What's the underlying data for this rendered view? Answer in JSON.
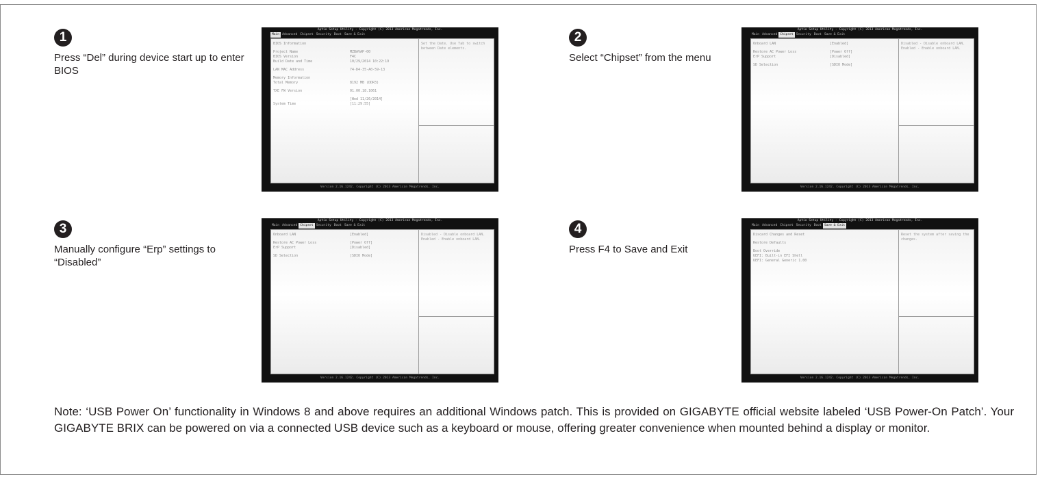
{
  "steps": [
    {
      "number": "1",
      "text": "Press “Del” during device start up to enter BIOS"
    },
    {
      "number": "2",
      "text": "Select “Chipset” from the menu"
    },
    {
      "number": "3",
      "text": "Manually configure “Erp” settings to “Disabled”"
    },
    {
      "number": "4",
      "text": "Press F4 to Save and Exit"
    }
  ],
  "bios": {
    "title": "Aptio Setup Utility - Copyright (C) 2013 American Megatrends, Inc.",
    "footer": "Version 2.16.1242. Copyright (C) 2013 American Megatrends, Inc.",
    "tabs": [
      "Main",
      "Advanced",
      "Chipset",
      "Security",
      "Boot",
      "Save & Exit"
    ],
    "screens": [
      {
        "active_tab": 0,
        "rows": [
          {
            "label": "BIOS Information",
            "value": "",
            "gap": false
          },
          {
            "label": "Project Name",
            "value": "MZBAVAP-00",
            "gap": true
          },
          {
            "label": "BIOS Version",
            "value": "F4C",
            "gap": false
          },
          {
            "label": "Build Date and Time",
            "value": "10/29/2014 10:22:19",
            "gap": false
          },
          {
            "label": "LAN MAC Address",
            "value": "74-D4-35-A0-59-13",
            "gap": true
          },
          {
            "label": "Memory Information",
            "value": "",
            "gap": true
          },
          {
            "label": "Total Memory",
            "value": "8192 MB (DDR3)",
            "gap": false
          },
          {
            "label": "TXE FW Version",
            "value": "01.00.18.1061",
            "gap": true
          },
          {
            "label": "",
            "value": "[Wed 11/26/2014]",
            "gap": true
          },
          {
            "label": "System Time",
            "value": "[11:29:55]",
            "gap": false
          }
        ],
        "help": "Set the Date. Use Tab to switch between Date elements."
      },
      {
        "active_tab": 2,
        "rows": [
          {
            "label": "Onboard LAN",
            "value": "[Enabled]",
            "gap": false
          },
          {
            "label": "Restore AC Power Loss",
            "value": "[Power Off]",
            "gap": true
          },
          {
            "label": "ErP Support",
            "value": "[Disabled]",
            "gap": false
          },
          {
            "label": "SD Selection",
            "value": "[SDIO Mode]",
            "gap": true
          }
        ],
        "help": "Disabled - Disable onboard LAN. Enabled - Enable onboard LAN."
      },
      {
        "active_tab": 2,
        "rows": [
          {
            "label": "Onboard LAN",
            "value": "[Enabled]",
            "gap": false
          },
          {
            "label": "Restore AC Power Loss",
            "value": "[Power Off]",
            "gap": true
          },
          {
            "label": "ErP Support",
            "value": "[Disabled]",
            "gap": false
          },
          {
            "label": "SD Selection",
            "value": "[SDIO Mode]",
            "gap": true
          }
        ],
        "help": "Disabled - Disable onboard LAN. Enabled - Enable onboard LAN."
      },
      {
        "active_tab": 5,
        "rows": [
          {
            "label": "Discard Changes and Reset",
            "value": "",
            "gap": false
          },
          {
            "label": "Restore Defaults",
            "value": "",
            "gap": true
          },
          {
            "label": "Boot Override",
            "value": "",
            "gap": true
          },
          {
            "label": "UEFI: Built-in EFI Shell",
            "value": "",
            "gap": false
          },
          {
            "label": "UEFI: General Generic 1.00",
            "value": "",
            "gap": false
          }
        ],
        "help": "Reset the system after saving the changes."
      }
    ]
  },
  "note": "Note: ‘USB Power On’ functionality in Windows 8 and above requires an additional Windows patch. This is provided on GIGABYTE official website labeled ‘USB Power-On Patch’. Your GIGABYTE BRIX can be powered on via a connected USB device such as a keyboard or mouse, offering greater convenience when mounted behind a display or monitor."
}
